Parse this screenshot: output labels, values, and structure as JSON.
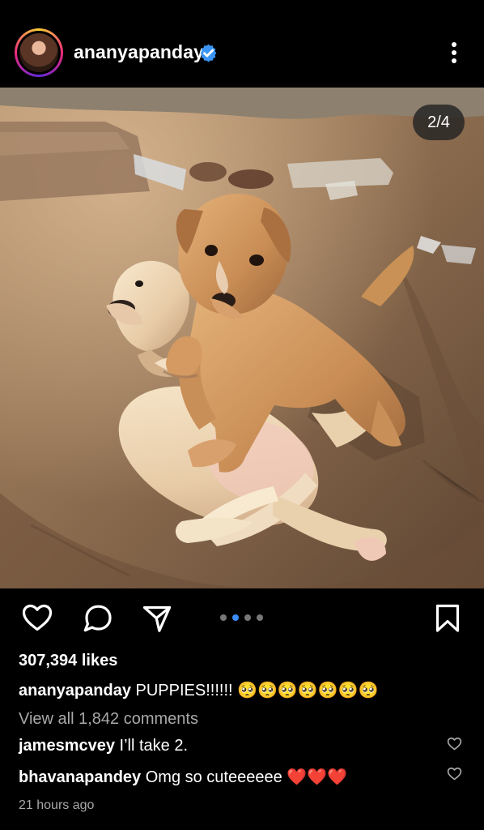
{
  "header": {
    "username": "ananyapanday"
  },
  "post": {
    "image_counter": "2/4",
    "carousel_active_index": 2,
    "carousel_visible_dots": 4,
    "likes_text": "307,394 likes",
    "caption_username": "ananyapanday",
    "caption_text": "PUPPIES!!!!!! 🥺🥺🥺🥺🥺🥺🥺",
    "view_comments_text": "View all 1,842 comments",
    "comments": [
      {
        "username": "jamesmcvey",
        "text": "I’ll take 2."
      },
      {
        "username": "bhavanapandey",
        "text": "Omg so cuteeeeee ❤️❤️❤️"
      }
    ],
    "timestamp": "21 hours ago"
  },
  "icons": {
    "verified": "verified-badge-icon",
    "more": "more-vertical-icon",
    "like": "heart-outline-icon",
    "comment": "comment-icon",
    "share": "paper-plane-icon",
    "save": "bookmark-icon"
  },
  "colors": {
    "background": "#000000",
    "verified_blue": "#3b95f5",
    "active_dot": "#3b8cf5",
    "secondary_text": "#a8a8a8"
  }
}
